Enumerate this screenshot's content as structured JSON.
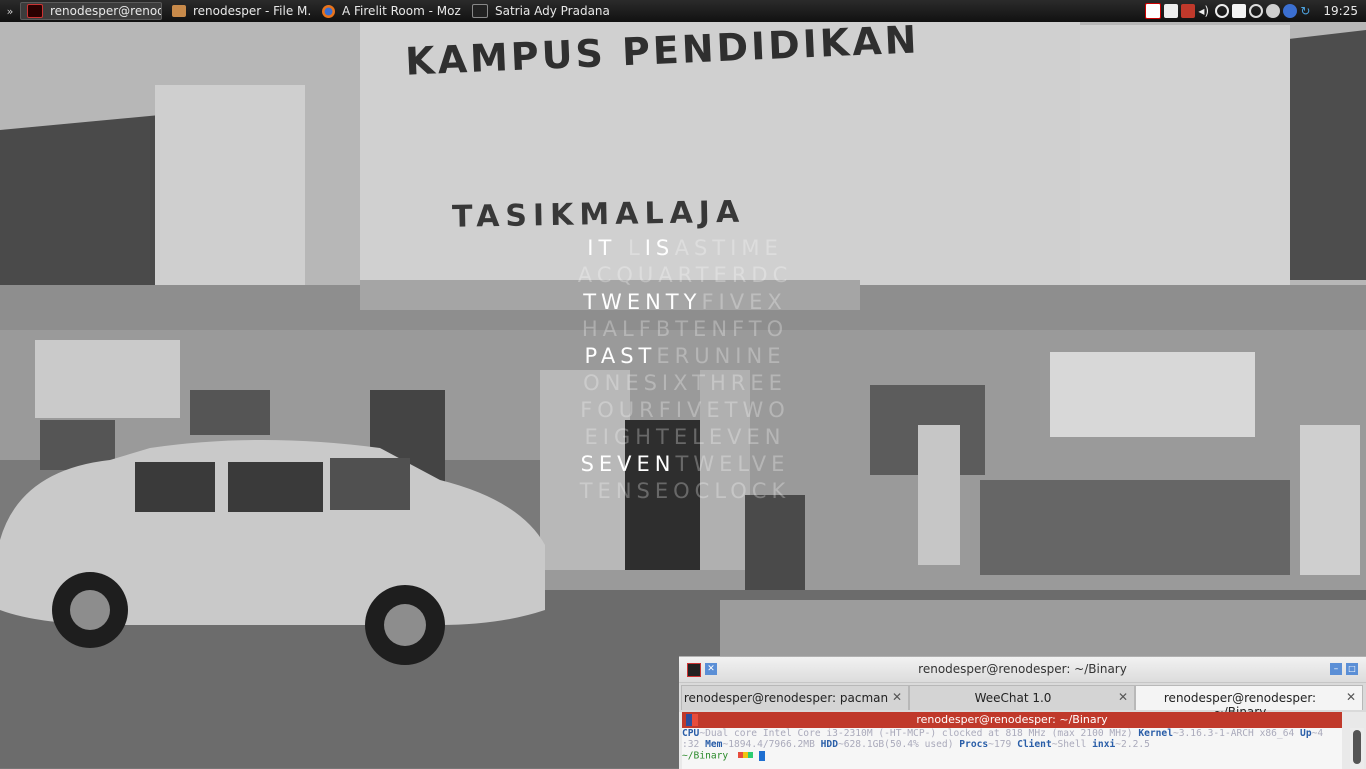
{
  "taskbar": {
    "tasks": [
      {
        "label": "renodesper@renod…",
        "icon": "terminal-icon",
        "active": true
      },
      {
        "label": "renodesper - File M…",
        "icon": "folder-icon",
        "active": false
      },
      {
        "label": "A Firelit Room - Moz…",
        "icon": "firefox-icon",
        "active": false
      },
      {
        "label": "Satria Ady Pradana",
        "icon": "terminal-icon",
        "active": false
      }
    ],
    "clock": "19:25"
  },
  "wallpaper": {
    "sign_title": "KAMPUS PENDIDIKAN",
    "sign_city": "TASIKMALAJA"
  },
  "wordclock": {
    "rows": [
      [
        {
          "t": "IT",
          "on": true
        },
        {
          "t": " ",
          "on": false
        },
        {
          "t": "L",
          "on": false
        },
        {
          "t": "IS",
          "on": true
        },
        {
          "t": "ASTIME",
          "on": false
        }
      ],
      [
        {
          "t": "ACQUARTERDC",
          "on": false
        }
      ],
      [
        {
          "t": "TWENTY",
          "on": true
        },
        {
          "t": "FIVEX",
          "on": false
        }
      ],
      [
        {
          "t": "HALFBTENFTO",
          "on": false
        }
      ],
      [
        {
          "t": "PAST",
          "on": true
        },
        {
          "t": "ERUNINE",
          "on": false
        }
      ],
      [
        {
          "t": "ONESIXTHREE",
          "on": false
        }
      ],
      [
        {
          "t": "FOURFIVETWO",
          "on": false
        }
      ],
      [
        {
          "t": "EIGHTELEVEN",
          "on": false
        }
      ],
      [
        {
          "t": "SEVEN",
          "on": true
        },
        {
          "t": "TWELVE",
          "on": false
        }
      ],
      [
        {
          "t": "TENSEOCLOCK",
          "on": false
        }
      ]
    ]
  },
  "terminal": {
    "title": "renodesper@renodesper: ~/Binary",
    "tabs": [
      {
        "label": "renodesper@renodesper: pacman",
        "selected": false
      },
      {
        "label": "WeeChat 1.0",
        "selected": false
      },
      {
        "label": "renodesper@renodesper: ~/Binary",
        "selected": true
      }
    ],
    "tab_close": "✕",
    "tmux_title": "renodesper@renodesper: ~/Binary",
    "line1": {
      "cpu_k": "CPU",
      "cpu_v": "~Dual core Intel Core i3-2310M (-HT-MCP-) clocked at 818 MHz (max 2100 MHz)",
      "kernel_k": "Kernel",
      "kernel_v": "~3.16.3-1-ARCH x86_64",
      "up_k": "Up",
      "up_v": "~4"
    },
    "line2": {
      "up_cont": ":32",
      "mem_k": "Mem",
      "mem_v": "~1894.4/7966.2MB",
      "hdd_k": "HDD",
      "hdd_v": "~628.1GB(50.4% used)",
      "procs_k": "Procs",
      "procs_v": "~179",
      "client_k": "Client",
      "client_v": "~Shell",
      "inxi_k": "inxi",
      "inxi_v": "~2.2.5"
    },
    "prompt": "~/Binary"
  }
}
